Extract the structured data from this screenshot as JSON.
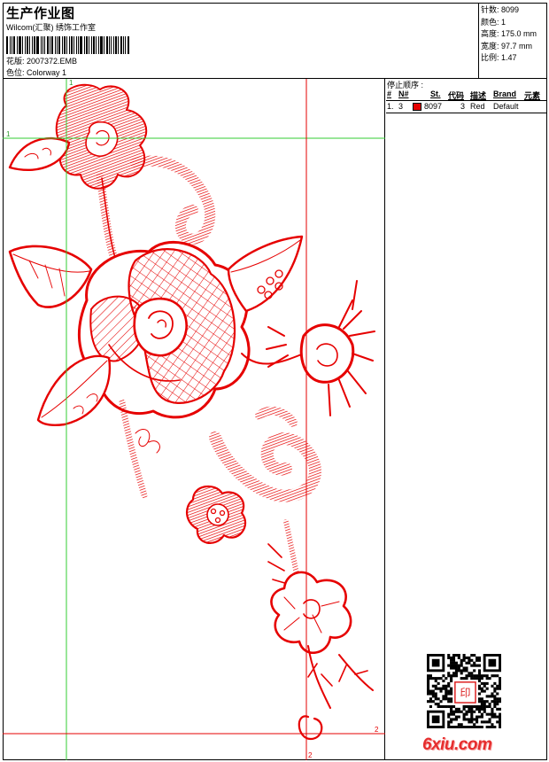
{
  "header": {
    "title": "生产作业图",
    "subtitle": "Wilcom(汇聚) 绣饰工作室",
    "design_label": "花版: 2007372.EMB",
    "colorway_label": "色位:  Colorway 1"
  },
  "specs": [
    {
      "label": "针数:",
      "value": "8099"
    },
    {
      "label": "颜色:",
      "value": "1"
    },
    {
      "label": "高度:",
      "value": "175.0 mm"
    },
    {
      "label": "宽度:",
      "value": "97.7 mm"
    },
    {
      "label": "比例:",
      "value": "1.47"
    }
  ],
  "stop_sequence": {
    "title": "停止顺序 :",
    "columns": [
      "#",
      "N#",
      "St.",
      "代码",
      "描述",
      "Brand",
      "元素"
    ],
    "rows": [
      {
        "index": "1.",
        "n": "3",
        "swatch_color": "#e60000",
        "stitches": "8097",
        "code": "3",
        "description": "Red",
        "brand": "Default",
        "element": ""
      }
    ]
  },
  "guides": {
    "marker_1_top": "1",
    "marker_1_left": "1",
    "marker_2_right": "2",
    "marker_2_bottom": "2"
  },
  "colors": {
    "thread": "#e60000",
    "guide_green": "#33cc33",
    "guide_red": "#e60000"
  },
  "watermark": {
    "text": "6xiu.com"
  },
  "qr": {
    "seal_text": "印"
  }
}
